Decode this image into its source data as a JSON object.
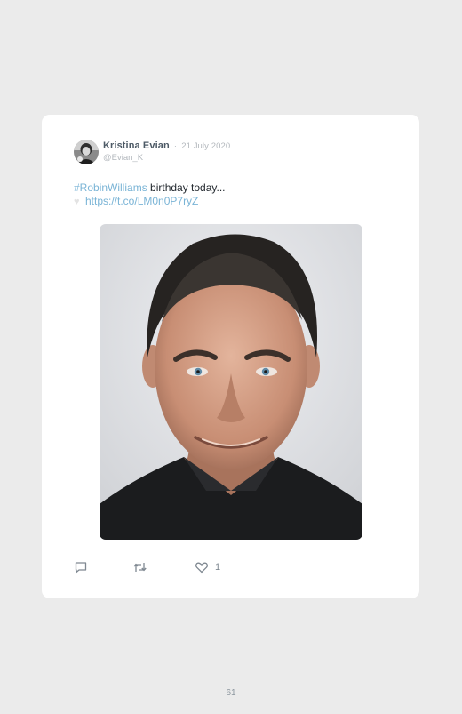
{
  "tweet": {
    "author_name": "Kristina Evian",
    "separator": "·",
    "date": "21 July 2020",
    "handle": "@Evian_K",
    "hashtag": "#RobinWilliams",
    "text": " birthday today...",
    "emoji_icon": "white-heart-icon",
    "link": "https://t.co/LM0n0P7ryZ",
    "link_color": "#7ab4d6",
    "photo_icon": "portrait-photo"
  },
  "actions": {
    "reply_icon": "reply-icon",
    "retweet_icon": "retweet-icon",
    "like_icon": "heart-icon",
    "like_count": "1"
  },
  "page": {
    "number": "61"
  }
}
